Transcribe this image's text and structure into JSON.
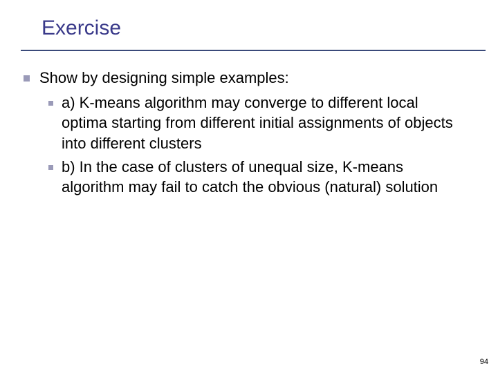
{
  "slide": {
    "title": "Exercise",
    "main_bullet": "Show by designing simple examples:",
    "sub_bullets": [
      "a) K-means algorithm may converge to different local optima starting from different initial assignments of objects into different clusters",
      "b) In the case of clusters of unequal size, K-means algorithm  may  fail to catch the obvious (natural)  solution"
    ],
    "page_number": "94"
  }
}
